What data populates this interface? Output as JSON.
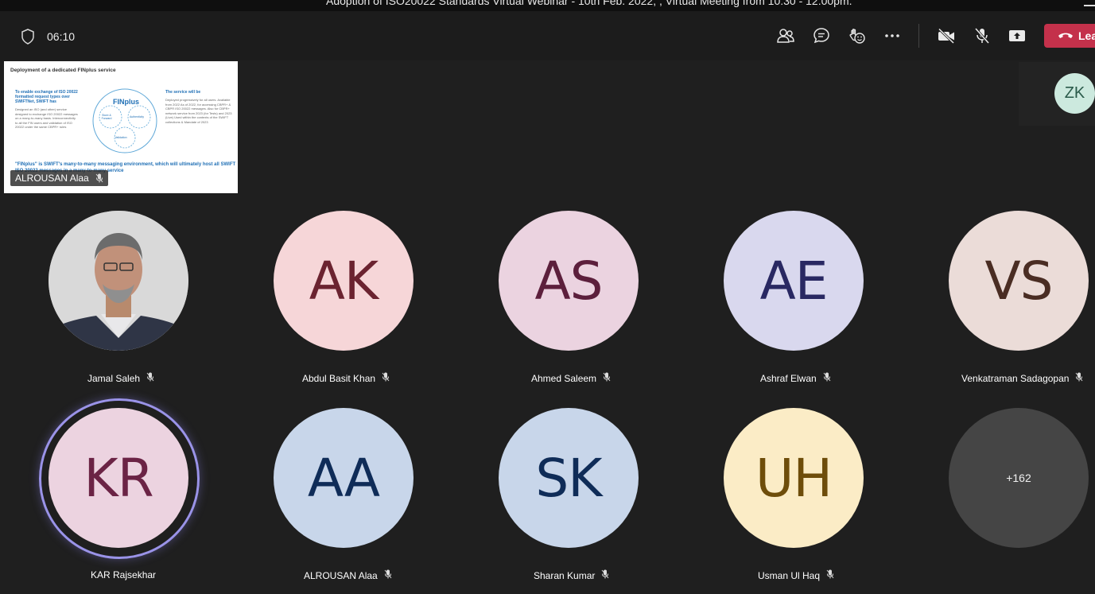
{
  "window": {
    "title": "Adoption of ISO20022 Standards Virtual Webinar - 10th Feb. 2022, , Virtual Meeting from 10:30 - 12:00pm."
  },
  "toolbar": {
    "timer": "06:10",
    "leave_label": "Leave",
    "leave_color": "#c4314b"
  },
  "shared_screen": {
    "slide_title": "Deployment of a dedicated FINplus service",
    "left_heading": "To enable exchange of ISO 20022 formatted request types over SWIFTNet, SWIFT has",
    "left_bullets": "Designed an ISO (and other) service designed to exchange ISO 20022 messages on a many-to-many basis. Interconnectivity to all the FIN users and validation of ISO 20022 under the same CBPR+ rules",
    "diagram_center": "FINplus",
    "diagram_nodes": [
      "Store & Forward",
      "Authenticity",
      "Validation"
    ],
    "right_heading": "The service will be",
    "right_bullets": "Deployed progressively for all users. Available from 2022 As of 2022, for accessing CBPR+ & CBPR ISO 20022 messages. Also for CBPR+ network service from 2023 (for Tests) and 2023 (Live) Used within the contexts of the SWIFT collections & Mandate of 2023",
    "footer_text": "\"FINplus\" is SWIFT's many-to-many messaging environment, which will ultimately host all SWIFT ISO 20022 messages in a many-to-many service",
    "presenter": "ALROUSAN Alaa"
  },
  "side_tile": {
    "initials": "ZK",
    "color": "#cce9de"
  },
  "participants": [
    {
      "name": "Jamal Saleh",
      "initials": "",
      "photo": true
    },
    {
      "name": "Abdul Basit Khan",
      "initials": "AK",
      "bg": "#f6d6d8",
      "fg": "#6b2330"
    },
    {
      "name": "Ahmed Saleem",
      "initials": "AS",
      "bg": "#ebd3e0",
      "fg": "#5c1f3c"
    },
    {
      "name": "Ashraf Elwan",
      "initials": "AE",
      "bg": "#d9d8ee",
      "fg": "#292862"
    },
    {
      "name": "Venkatraman Sadagopan",
      "initials": "VS",
      "bg": "#ebdcd8",
      "fg": "#4a2d23"
    },
    {
      "name": "KAR Rajsekhar",
      "initials": "KR",
      "bg": "#ecd3e0",
      "fg": "#6b2345",
      "speaking": true
    },
    {
      "name": "ALROUSAN Alaa",
      "initials": "AA",
      "bg": "#c8d6ea",
      "fg": "#0f2c58"
    },
    {
      "name": "Sharan Kumar",
      "initials": "SK",
      "bg": "#c8d6ea",
      "fg": "#0f2c58"
    },
    {
      "name": "Usman Ul Haq",
      "initials": "UH",
      "bg": "#fbecc6",
      "fg": "#6e4d0a"
    }
  ],
  "overflow": {
    "label": "+162"
  }
}
